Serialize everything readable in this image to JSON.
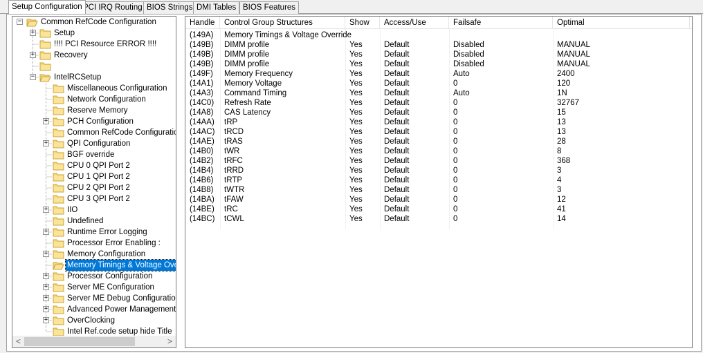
{
  "tabs": [
    {
      "label": "Setup Configuration",
      "active": true
    },
    {
      "label": "PCI IRQ Routing",
      "active": false
    },
    {
      "label": "BIOS Strings",
      "active": false
    },
    {
      "label": "DMI Tables",
      "active": false
    },
    {
      "label": "BIOS Features",
      "active": false
    }
  ],
  "tree": {
    "items": [
      {
        "label": "Common RefCode Configuration",
        "level": 0,
        "expander": "minus",
        "open": true
      },
      {
        "label": "Setup",
        "level": 1,
        "expander": "plus"
      },
      {
        "label": "!!!! PCI Resource ERROR !!!!",
        "level": 1,
        "expander": "none"
      },
      {
        "label": "Recovery",
        "level": 1,
        "expander": "plus"
      },
      {
        "label": "",
        "level": 1,
        "expander": "none"
      },
      {
        "label": "IntelRCSetup",
        "level": 1,
        "expander": "minus",
        "open": true
      },
      {
        "label": "Miscellaneous Configuration",
        "level": 2,
        "expander": "none"
      },
      {
        "label": "Network Configuration",
        "level": 2,
        "expander": "none"
      },
      {
        "label": "Reserve Memory",
        "level": 2,
        "expander": "none"
      },
      {
        "label": "PCH Configuration",
        "level": 2,
        "expander": "plus"
      },
      {
        "label": "Common RefCode Configuration",
        "level": 2,
        "expander": "none"
      },
      {
        "label": "QPI Configuration",
        "level": 2,
        "expander": "plus"
      },
      {
        "label": "BGF override",
        "level": 2,
        "expander": "none"
      },
      {
        "label": "CPU 0 QPI Port 2",
        "level": 2,
        "expander": "none"
      },
      {
        "label": "CPU 1 QPI Port 2",
        "level": 2,
        "expander": "none"
      },
      {
        "label": "CPU 2 QPI Port 2",
        "level": 2,
        "expander": "none"
      },
      {
        "label": "CPU 3 QPI Port 2",
        "level": 2,
        "expander": "none"
      },
      {
        "label": "IIO",
        "level": 2,
        "expander": "plus"
      },
      {
        "label": "Undefined",
        "level": 2,
        "expander": "none"
      },
      {
        "label": "Runtime Error Logging",
        "level": 2,
        "expander": "plus"
      },
      {
        "label": "Processor Error Enabling :",
        "level": 2,
        "expander": "none"
      },
      {
        "label": "Memory Configuration",
        "level": 2,
        "expander": "plus"
      },
      {
        "label": "Memory Timings & Voltage Overri",
        "level": 2,
        "expander": "none",
        "selected": true,
        "open": true
      },
      {
        "label": "Processor Configuration",
        "level": 2,
        "expander": "plus"
      },
      {
        "label": "Server ME Configuration",
        "level": 2,
        "expander": "plus"
      },
      {
        "label": "Server ME Debug Configuration",
        "level": 2,
        "expander": "plus"
      },
      {
        "label": "Advanced Power Management C",
        "level": 2,
        "expander": "plus"
      },
      {
        "label": "OverClocking",
        "level": 2,
        "expander": "plus"
      },
      {
        "label": "Intel Ref.code setup hide Title",
        "level": 2,
        "expander": "none"
      }
    ],
    "scroll_left": "<",
    "scroll_right": ">"
  },
  "table": {
    "columns": [
      "Handle",
      "Control Group Structures",
      "Show",
      "Access/Use",
      "Failsafe",
      "Optimal"
    ],
    "rows": [
      [
        "(149A)",
        "Memory Timings & Voltage Override",
        "",
        "",
        "",
        ""
      ],
      [
        "(149B)",
        "DIMM profile",
        "Yes",
        "Default",
        "Disabled",
        "MANUAL"
      ],
      [
        "(149B)",
        "DIMM profile",
        "Yes",
        "Default",
        "Disabled",
        "MANUAL"
      ],
      [
        "(149B)",
        "DIMM profile",
        "Yes",
        "Default",
        "Disabled",
        "MANUAL"
      ],
      [
        "(149F)",
        "Memory Frequency",
        "Yes",
        "Default",
        "Auto",
        "2400"
      ],
      [
        "(14A1)",
        "Memory Voltage",
        "Yes",
        "Default",
        "0",
        "120"
      ],
      [
        "(14A3)",
        "Command Timing",
        "Yes",
        "Default",
        "Auto",
        "1N"
      ],
      [
        "(14C0)",
        "Refresh Rate",
        "Yes",
        "Default",
        "0",
        "32767"
      ],
      [
        "(14A8)",
        "CAS Latency",
        "Yes",
        "Default",
        "0",
        "15"
      ],
      [
        "(14AA)",
        "tRP",
        "Yes",
        "Default",
        "0",
        "13"
      ],
      [
        "(14AC)",
        "tRCD",
        "Yes",
        "Default",
        "0",
        "13"
      ],
      [
        "(14AE)",
        "tRAS",
        "Yes",
        "Default",
        "0",
        "28"
      ],
      [
        "(14B0)",
        "tWR",
        "Yes",
        "Default",
        "0",
        "8"
      ],
      [
        "(14B2)",
        "tRFC",
        "Yes",
        "Default",
        "0",
        "368"
      ],
      [
        "(14B4)",
        "tRRD",
        "Yes",
        "Default",
        "0",
        "3"
      ],
      [
        "(14B6)",
        "tRTP",
        "Yes",
        "Default",
        "0",
        "4"
      ],
      [
        "(14B8)",
        "tWTR",
        "Yes",
        "Default",
        "0",
        "3"
      ],
      [
        "(14BA)",
        "tFAW",
        "Yes",
        "Default",
        "0",
        "12"
      ],
      [
        "(14BE)",
        "tRC",
        "Yes",
        "Default",
        "0",
        "41"
      ],
      [
        "(14BC)",
        "tCWL",
        "Yes",
        "Default",
        "0",
        "14"
      ]
    ]
  },
  "colors": {
    "selection": "#0078d7",
    "folder_fill": "#f8d775",
    "folder_edge": "#c8a43a"
  }
}
